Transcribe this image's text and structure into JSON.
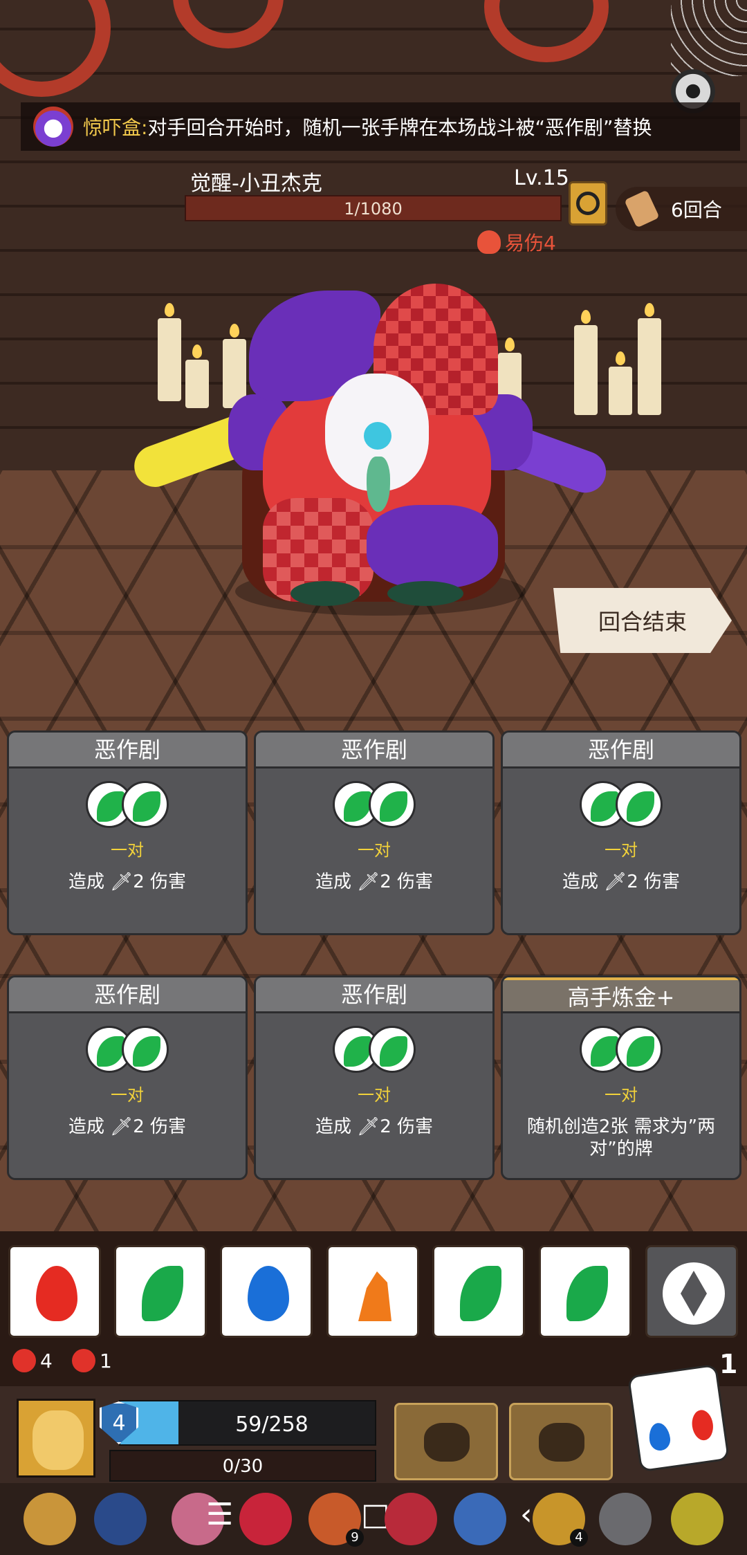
{
  "banner": {
    "label": "惊吓盒:",
    "text": "对手回合开始时，随机一张手牌在本场战斗被“恶作剧”替换"
  },
  "boss": {
    "name": "觉醒-小丑杰克",
    "level": "Lv.15",
    "hp_text": "1/1080",
    "hp_current": 1,
    "hp_max": 1080,
    "status": "易伤4"
  },
  "turn": {
    "label": "6回合"
  },
  "end_turn_button": "回合结束",
  "cards": [
    {
      "title": "恶作剧",
      "requirement": "一对",
      "desc": "造成 🗡2 伤害",
      "style": "normal"
    },
    {
      "title": "恶作剧",
      "requirement": "一对",
      "desc": "造成 🗡2 伤害",
      "style": "normal"
    },
    {
      "title": "恶作剧",
      "requirement": "一对",
      "desc": "造成 🗡2 伤害",
      "style": "normal"
    },
    {
      "title": "恶作剧",
      "requirement": "一对",
      "desc": "造成 🗡2 伤害",
      "style": "normal"
    },
    {
      "title": "恶作剧",
      "requirement": "一对",
      "desc": "造成 🗡2 伤害",
      "style": "normal"
    },
    {
      "title": "高手炼金+",
      "requirement": "一对",
      "desc": "随机创造2张 需求为”两对”的牌",
      "style": "gold"
    }
  ],
  "dice": [
    "fire-icon",
    "leaf-icon",
    "drop-icon",
    "rock-icon",
    "leaf-icon",
    "leaf-icon",
    "gem-icon"
  ],
  "player_stats": {
    "strength": "4",
    "curse": "1",
    "dice_count": "1"
  },
  "player": {
    "shield": "4",
    "hp_text": "59/258",
    "hp_current": 59,
    "hp_max": 258,
    "xp_text": "0/30"
  },
  "bottom_bar": {
    "badge_1": "9",
    "badge_2": "4"
  }
}
